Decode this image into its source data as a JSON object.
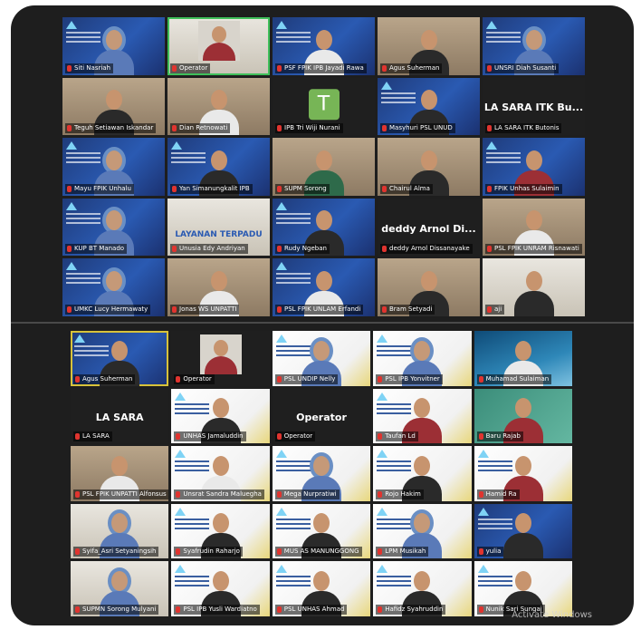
{
  "watermark": "Activate Windows",
  "top_grid": [
    {
      "name": "Siti Nasriah",
      "style": "slide",
      "person": "hijab"
    },
    {
      "name": "Operator",
      "style": "white-inset",
      "person": "red",
      "active": "speaking"
    },
    {
      "name": "PSF FPIK IPB Jayadi Rawa",
      "style": "slide",
      "person": "white"
    },
    {
      "name": "Agus Suherman",
      "style": "room",
      "person": "black"
    },
    {
      "name": "UNSRI Diah Susanti",
      "style": "slide",
      "person": "hijab"
    },
    {
      "name": "Teguh Setiawan Iskandar",
      "style": "room",
      "person": "black"
    },
    {
      "name": "Dian Retnowati",
      "style": "room",
      "person": "white"
    },
    {
      "name": "IPB Tri Wiji Nurani",
      "style": "avatar",
      "avatar_letter": "T"
    },
    {
      "name": "Masyhuri PSL UNUD",
      "style": "slide",
      "person": "black"
    },
    {
      "name": "LA SARA ITK Butonis",
      "style": "text",
      "big_text": "LA SARA ITK Bu..."
    },
    {
      "name": "Mayu FPIK Unhalu",
      "style": "slide",
      "person": "hijab"
    },
    {
      "name": "Yan Simanungkalit IPB",
      "style": "slide",
      "person": "black"
    },
    {
      "name": "SUPM Sorong",
      "style": "room",
      "person": "green"
    },
    {
      "name": "Chairul Alma",
      "style": "room",
      "person": "black"
    },
    {
      "name": "FPIK Unhas Sulaimin",
      "style": "slide",
      "person": "red"
    },
    {
      "name": "KUP BT Manado",
      "style": "slide",
      "person": "hijab"
    },
    {
      "name": "Unusia Edy Andriyan",
      "style": "wall",
      "big_text": "LAYANAN TERPADU"
    },
    {
      "name": "Rudy Ngeban",
      "style": "slide",
      "person": "black"
    },
    {
      "name": "deddy Arnol Dissanayake",
      "style": "text",
      "big_text": "deddy Arnol Di..."
    },
    {
      "name": "PSL FPIK UNRAM Risnawati",
      "style": "room",
      "person": "white"
    },
    {
      "name": "UMKC Lucy Hermawaty",
      "style": "slide",
      "person": "hijab"
    },
    {
      "name": "Jonas WS UNPATTI",
      "style": "room",
      "person": "white"
    },
    {
      "name": "PSL FPIK UNLAM Erfandi",
      "style": "slide",
      "person": "white"
    },
    {
      "name": "Bram Setyadi",
      "style": "room",
      "person": "black"
    },
    {
      "name": "aji",
      "style": "wall",
      "person": "black"
    }
  ],
  "bottom_grid": [
    {
      "name": "Agus Suherman",
      "style": "slide",
      "person": "black",
      "active": "yellow"
    },
    {
      "name": "Operator",
      "style": "dark-inset",
      "person": "red"
    },
    {
      "name": "PSL UNDIP Nelly",
      "style": "white",
      "person": "hijab"
    },
    {
      "name": "PSL IPB Yonvitner",
      "style": "white",
      "person": "hijab"
    },
    {
      "name": "Muhamad Sulaiman",
      "style": "ocean",
      "person": "white"
    },
    {
      "name": "LA SARA",
      "style": "dark",
      "big_text": "LA SARA"
    },
    {
      "name": "UNHAS Jamaluddin",
      "style": "white",
      "person": "black"
    },
    {
      "name": "Operator",
      "style": "dark",
      "big_text": "Operator"
    },
    {
      "name": "Taufan Ld",
      "style": "white",
      "person": "red"
    },
    {
      "name": "Baru Rajab",
      "style": "green",
      "person": "red"
    },
    {
      "name": "PSL FPIK UNPATTI Alfonsus",
      "style": "room",
      "person": "white"
    },
    {
      "name": "Unsrat Sandra Maluegha",
      "style": "white",
      "person": "white"
    },
    {
      "name": "Mega Nurpratiwi",
      "style": "white",
      "person": "hijab"
    },
    {
      "name": "Rojo Hakim",
      "style": "white",
      "person": "black"
    },
    {
      "name": "Hamid Ra",
      "style": "white",
      "person": "red"
    },
    {
      "name": "Syifa_Asri Setyaningsih",
      "style": "wall",
      "person": "hijab"
    },
    {
      "name": "Syafrudin Raharjo",
      "style": "white",
      "person": "black"
    },
    {
      "name": "MUS AS MANUNGGONG",
      "style": "white",
      "person": "black"
    },
    {
      "name": "LPM Musikah",
      "style": "white",
      "person": "hijab"
    },
    {
      "name": "yulia",
      "style": "slide",
      "person": "black"
    },
    {
      "name": "SUPMN Sorong Mulyani",
      "style": "wall",
      "person": "hijab"
    },
    {
      "name": "PSL IPB Yusli Wardiatno",
      "style": "white",
      "person": "black"
    },
    {
      "name": "PSL UNHAS Ahmad",
      "style": "white",
      "person": "black"
    },
    {
      "name": "Hafidz Syahruddin",
      "style": "white",
      "person": "black"
    },
    {
      "name": "Nunik Sari Sungai",
      "style": "white",
      "person": "black"
    }
  ]
}
